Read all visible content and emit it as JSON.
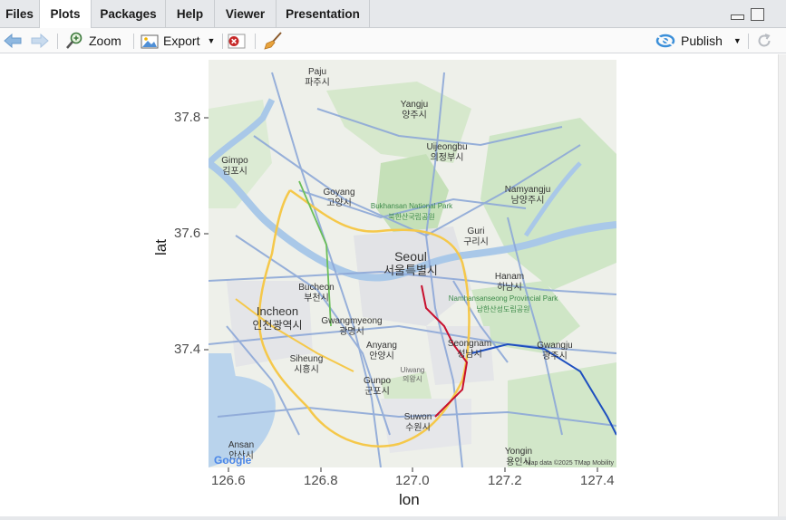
{
  "tabs": [
    {
      "label": "Files"
    },
    {
      "label": "Plots"
    },
    {
      "label": "Packages"
    },
    {
      "label": "Help"
    },
    {
      "label": "Viewer"
    },
    {
      "label": "Presentation"
    }
  ],
  "toolbar": {
    "zoom_label": "Zoom",
    "export_label": "Export",
    "publish_label": "Publish"
  },
  "plot": {
    "xlabel": "lon",
    "ylabel": "lat",
    "x_ticks": [
      "126.6",
      "126.8",
      "127.0",
      "127.2",
      "127.4"
    ],
    "y_ticks": [
      "37.8",
      "37.6",
      "37.4"
    ],
    "attribution": "Map data ©2025 TMap Mobility",
    "google_logo": "Google",
    "places": [
      {
        "en": "Paju",
        "ko": "파주시"
      },
      {
        "en": "Yangju",
        "ko": "양주시"
      },
      {
        "en": "Uijeongbu",
        "ko": "의정부시"
      },
      {
        "en": "Gimpo",
        "ko": "김포시"
      },
      {
        "en": "Goyang",
        "ko": "고양시"
      },
      {
        "en": "Namyangju",
        "ko": "남양주시"
      },
      {
        "en": "Guri",
        "ko": "구리시"
      },
      {
        "en": "Seoul",
        "ko": "서울특별시"
      },
      {
        "en": "Hanam",
        "ko": "하남시"
      },
      {
        "en": "Bucheon",
        "ko": "부천시"
      },
      {
        "en": "Incheon",
        "ko": "인천광역시"
      },
      {
        "en": "Gwangmyeong",
        "ko": "광명시"
      },
      {
        "en": "Anyang",
        "ko": "안양시"
      },
      {
        "en": "Seongnam",
        "ko": "성남시"
      },
      {
        "en": "Gwangju",
        "ko": "광주시"
      },
      {
        "en": "Siheung",
        "ko": "시흥시"
      },
      {
        "en": "Gunpo",
        "ko": "군포시"
      },
      {
        "en": "Uiwang",
        "ko": "의왕시"
      },
      {
        "en": "Suwon",
        "ko": "수원시"
      },
      {
        "en": "Ansan",
        "ko": "안산시"
      },
      {
        "en": "Yongin",
        "ko": "용인시"
      },
      {
        "en": "Bukhansan National Park",
        "ko": "북한산국립공원"
      },
      {
        "en": "Namhansanseong Provincial Park",
        "ko": "남한산성도립공원"
      }
    ]
  },
  "colors": {
    "map_land": "#eef0ea",
    "map_green": "#cfe6c6",
    "map_water": "#a9c8e8",
    "road_main": "#8da8d8",
    "road_yellow": "#f5c84a",
    "road_red": "#c8102e"
  }
}
